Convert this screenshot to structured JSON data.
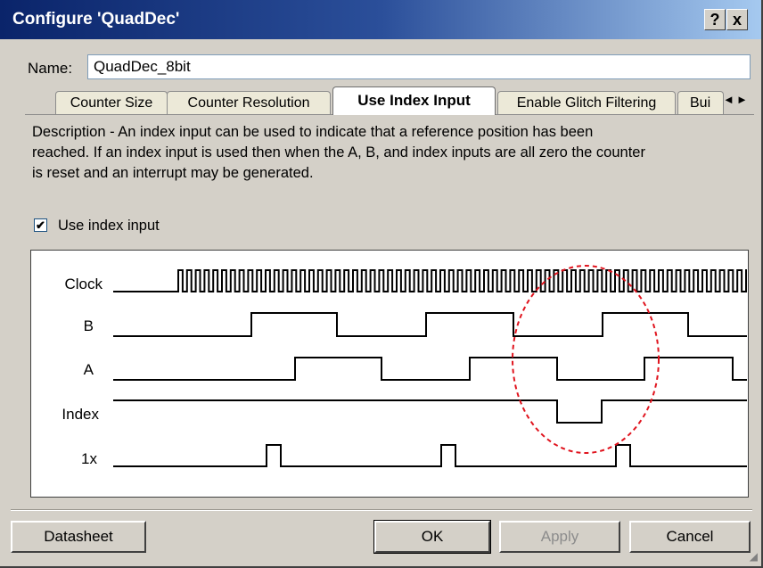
{
  "window": {
    "title": "Configure 'QuadDec'",
    "help_button": "?",
    "close_button": "x"
  },
  "name_field": {
    "label": "Name:",
    "value": "QuadDec_8bit"
  },
  "tabs": [
    {
      "label": "Counter Size",
      "active": false
    },
    {
      "label": "Counter Resolution",
      "active": false
    },
    {
      "label": "Use Index Input",
      "active": true
    },
    {
      "label": "Enable Glitch Filtering",
      "active": false
    },
    {
      "label": "Bui",
      "active": false
    }
  ],
  "tab_scroll": {
    "left": "◄",
    "right": "►"
  },
  "description": "Description - An index input can be used to indicate that a reference position has been reached. If an index input is used then when the A, B, and index inputs are all zero the counter is reset and an interrupt may be generated.",
  "checkbox": {
    "label": "Use index input",
    "checked": true,
    "mark": "✔"
  },
  "timing_diagram": {
    "signals": [
      "Clock",
      "B",
      "A",
      "Index",
      "1x"
    ],
    "highlight_color": "#e0141e"
  },
  "buttons": {
    "datasheet": "Datasheet",
    "ok": "OK",
    "apply": "Apply",
    "cancel": "Cancel"
  }
}
